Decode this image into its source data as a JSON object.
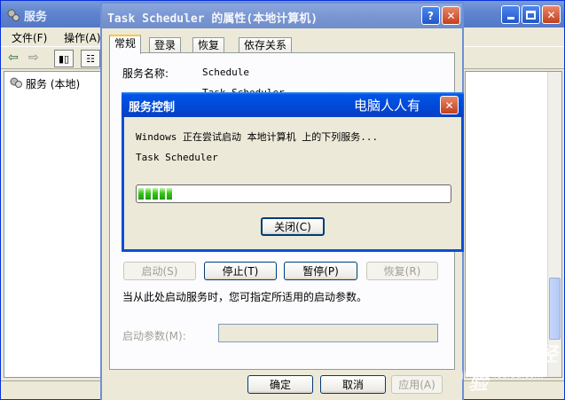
{
  "services_window": {
    "title": "服务",
    "menu": [
      "文件(F)",
      "操作(A)"
    ],
    "tree_item": "服务 (本地)"
  },
  "properties_dialog": {
    "title": "Task Scheduler 的属性(本地计算机)",
    "help_btn": "?",
    "close_btn": "✕",
    "tabs": [
      "常规",
      "登录",
      "恢复",
      "依存关系"
    ],
    "service_name_label": "服务名称:",
    "service_name_value": "Schedule",
    "display_name_value_partial": "Task Scheduler",
    "buttons": {
      "start": "启动(S)",
      "stop": "停止(T)",
      "pause": "暂停(P)",
      "resume": "恢复(R)"
    },
    "hint": "当从此处启动服务时，您可指定所适用的启动参数。",
    "param_label": "启动参数(M):",
    "footer": {
      "ok": "确定",
      "cancel": "取消",
      "apply": "应用(A)"
    }
  },
  "service_control": {
    "title": "服务控制",
    "watermark": "电脑人人有",
    "message": "Windows 正在尝试启动 本地计算机 上的下列服务...",
    "service": "Task Scheduler",
    "progress_blocks": 5,
    "close_label": "关闭(C)"
  },
  "watermark": {
    "logo": "Baidu 经验",
    "url": "jingyan.baidu.com"
  }
}
